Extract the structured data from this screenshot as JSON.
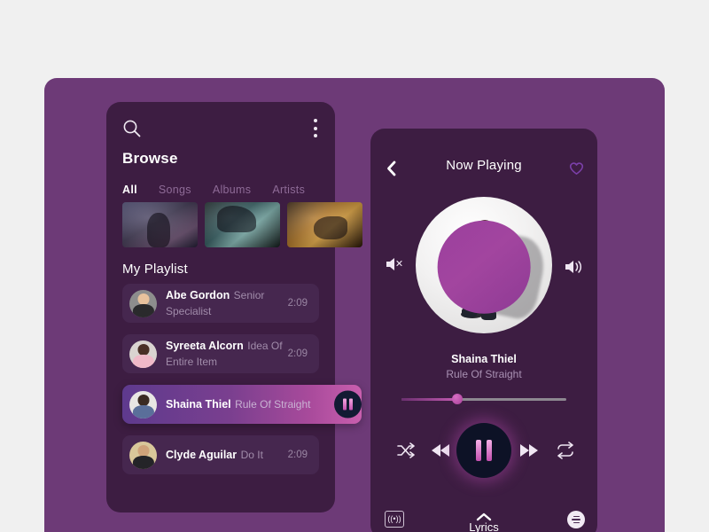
{
  "browse": {
    "search_icon": "search-icon",
    "menu_icon": "kebab-menu-icon",
    "title": "Browse",
    "tabs": [
      {
        "label": "All",
        "active": true
      },
      {
        "label": "Songs",
        "active": false
      },
      {
        "label": "Albums",
        "active": false
      },
      {
        "label": "Artists",
        "active": false
      }
    ],
    "thumbnails": [
      {
        "name": "concert-thumbnail-1"
      },
      {
        "name": "concert-thumbnail-2"
      },
      {
        "name": "concert-thumbnail-3"
      }
    ],
    "playlist_title": "My Playlist",
    "tracks": [
      {
        "name": "Abe Gordon",
        "subtitle": "Senior Specialist",
        "time": "2:09",
        "active": false
      },
      {
        "name": "Syreeta Alcorn",
        "subtitle": "Idea Of Entire Item",
        "time": "2:09",
        "active": false
      },
      {
        "name": "Shaina Thiel",
        "subtitle": "Rule Of Straight",
        "time": "",
        "active": true
      },
      {
        "name": "Clyde Aguilar",
        "subtitle": "Do It",
        "time": "2:09",
        "active": false
      }
    ]
  },
  "now_playing": {
    "back_icon": "chevron-left-icon",
    "title": "Now Playing",
    "favorite_icon": "heart-outline-icon",
    "album_art": "album-art-singer-on-stool",
    "volume_down_icon": "volume-mute-icon",
    "volume_up_icon": "volume-up-icon",
    "song": "Shaina Thiel",
    "artist": "Rule Of Straight",
    "progress_percent": 34,
    "controls": {
      "shuffle": "shuffle-icon",
      "previous": "rewind-icon",
      "play_pause": "pause-icon",
      "next": "fast-forward-icon",
      "repeat": "repeat-icon"
    },
    "cast_label": "((•))",
    "lyrics_label": "Lyrics",
    "chevron_up_icon": "chevron-up-icon",
    "queue_icon": "queue-list-icon"
  },
  "colors": {
    "page_bg": "#f0f0f0",
    "card_bg": "#6d3a77",
    "panel_bg": "#3d1d42",
    "row_bg": "#46274f",
    "accent_pink": "#c45bb2",
    "play_btn_bg": "#0d1226"
  }
}
